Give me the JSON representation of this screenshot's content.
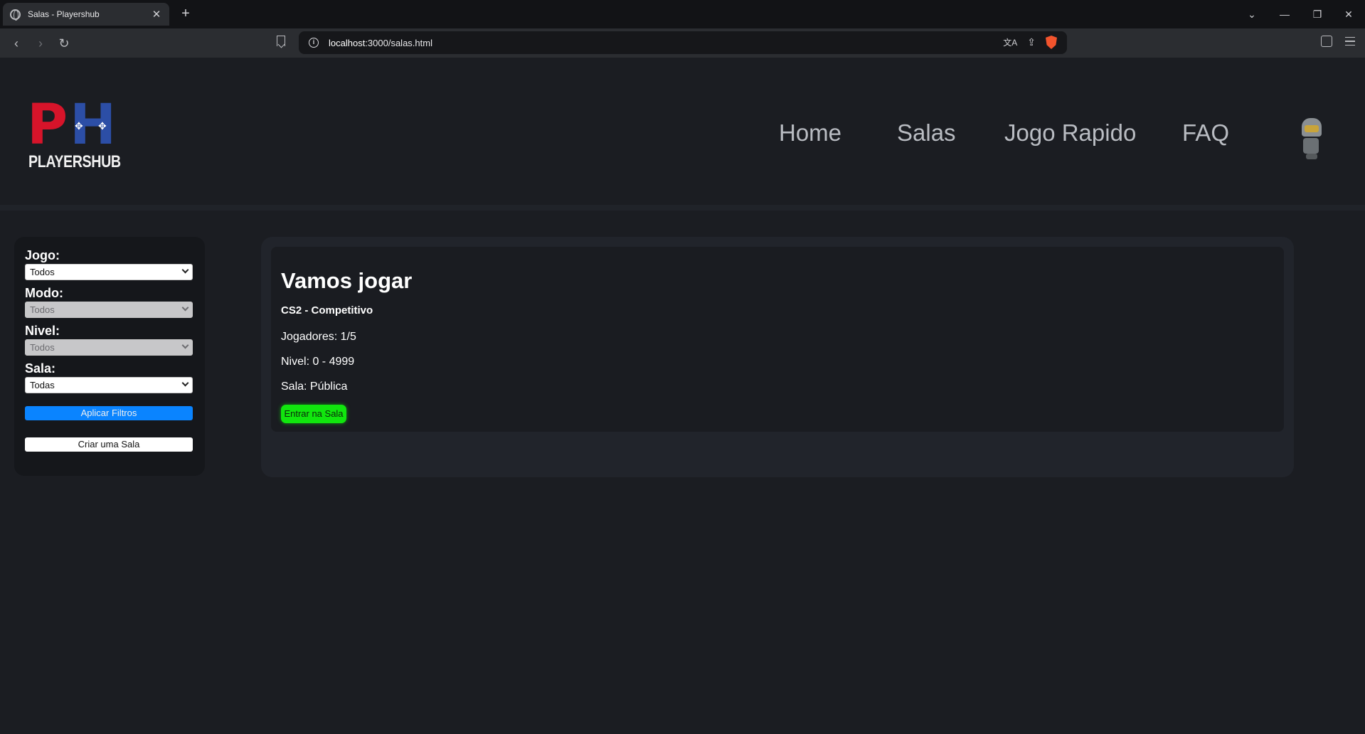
{
  "browser": {
    "tab_title": "Salas - Playershub",
    "tab_close": "✕",
    "new_tab": "+",
    "url_host": "localhost",
    "url_path": ":3000/salas.html",
    "icons": [
      "globe-icon",
      "back-icon",
      "forward-icon",
      "reload-icon",
      "bookmark-icon",
      "info-icon",
      "translate-icon",
      "share-icon",
      "brave-shield-icon",
      "extensions-icon",
      "menu-icon"
    ],
    "window_controls": {
      "tabs_menu": "⌄",
      "minimize": "—",
      "restore": "❐",
      "close": "✕"
    },
    "nav_glyphs": {
      "back": "‹",
      "forward": "›",
      "reload": "↻",
      "translate": "文A",
      "share": "⇪",
      "info": "i"
    }
  },
  "site": {
    "logo": {
      "letter_p": "P",
      "letter_h": "H",
      "wordmark": "PLAYERSHUB"
    },
    "nav": [
      "Home",
      "Salas",
      "Jogo Rapido",
      "FAQ"
    ]
  },
  "filters": {
    "jogo": {
      "label": "Jogo:",
      "value": "Todos",
      "enabled": true
    },
    "modo": {
      "label": "Modo:",
      "value": "Todos",
      "enabled": false
    },
    "nivel": {
      "label": "Nivel:",
      "value": "Todos",
      "enabled": false
    },
    "sala": {
      "label": "Sala:",
      "value": "Todas",
      "enabled": true
    },
    "apply_label": "Aplicar Filtros",
    "create_label": "Criar uma Sala",
    "apply_color": "#0a84ff"
  },
  "rooms": [
    {
      "title": "Vamos jogar",
      "game_mode": "CS2 - Competitivo",
      "players": "Jogadores: 1/5",
      "level": "Nivel: 0 - 4999",
      "visibility": "Sala: Pública",
      "enter_label": "Entrar na Sala",
      "enter_color": "#11e60e"
    }
  ]
}
